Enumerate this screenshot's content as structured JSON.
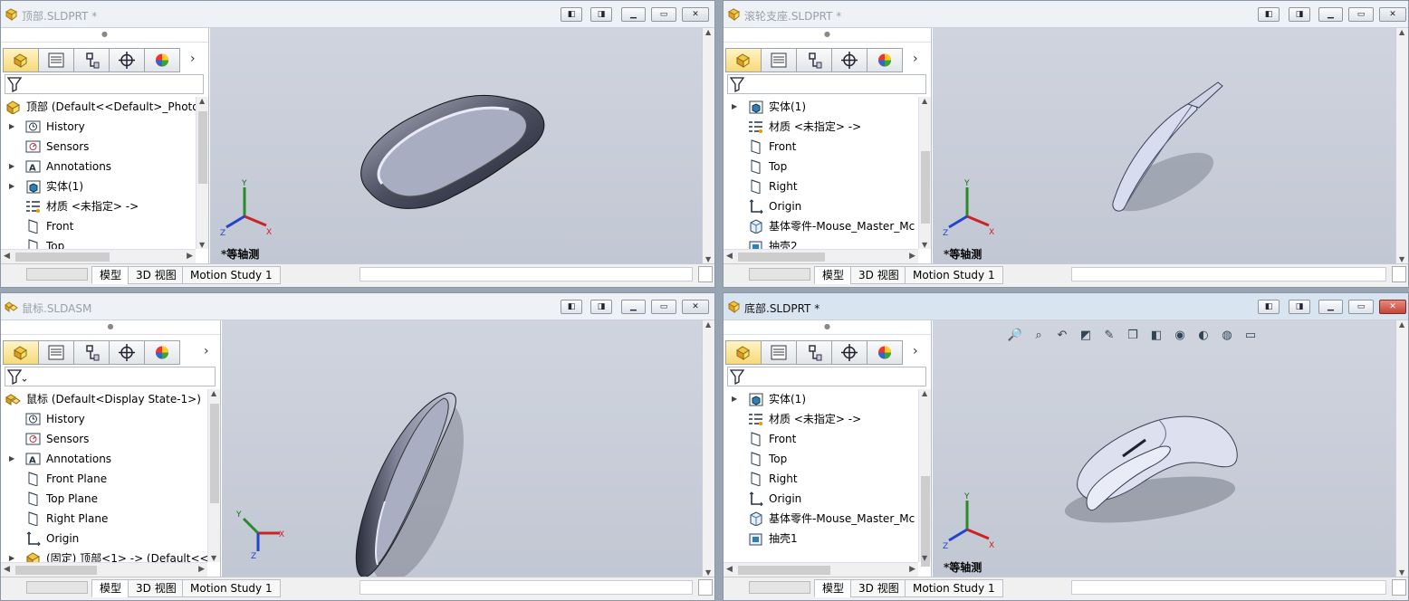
{
  "windows": [
    {
      "id": "w1",
      "title": "顶部.SLDPRT *",
      "active": false,
      "tree": [
        {
          "label": "顶部  (Default<<Default>_Photo",
          "icon": "part-icon",
          "expand": "",
          "root": true
        },
        {
          "label": "History",
          "icon": "history-icon",
          "expand": "▶"
        },
        {
          "label": "Sensors",
          "icon": "sensors-icon",
          "expand": ""
        },
        {
          "label": "Annotations",
          "icon": "annotations-icon",
          "expand": "▶"
        },
        {
          "label": "实体(1)",
          "icon": "solid-body-icon",
          "expand": "▶"
        },
        {
          "label": "材质 <未指定> ->",
          "icon": "material-icon",
          "expand": ""
        },
        {
          "label": "Front",
          "icon": "plane-icon",
          "expand": ""
        },
        {
          "label": "Top",
          "icon": "plane-icon",
          "expand": ""
        }
      ],
      "view_label": "*等轴测",
      "tabs": [
        "模型",
        "3D 视图",
        "Motion Study 1"
      ]
    },
    {
      "id": "w2",
      "title": "滚轮支座.SLDPRT *",
      "active": false,
      "tree": [
        {
          "label": "实体(1)",
          "icon": "solid-body-icon",
          "expand": "▶"
        },
        {
          "label": "材质 <未指定> ->",
          "icon": "material-icon",
          "expand": ""
        },
        {
          "label": "Front",
          "icon": "plane-icon",
          "expand": ""
        },
        {
          "label": "Top",
          "icon": "plane-icon",
          "expand": ""
        },
        {
          "label": "Right",
          "icon": "plane-icon",
          "expand": ""
        },
        {
          "label": "Origin",
          "icon": "origin-icon",
          "expand": ""
        },
        {
          "label": "基体零件-Mouse_Master_Mc",
          "icon": "base-part-icon",
          "expand": ""
        },
        {
          "label": "抽壳2",
          "icon": "shell-icon",
          "expand": ""
        }
      ],
      "view_label": "*等轴测",
      "tabs": [
        "模型",
        "3D 视图",
        "Motion Study 1"
      ]
    },
    {
      "id": "w3",
      "title": "鼠标.SLDASM",
      "active": false,
      "tree": [
        {
          "label": "鼠标  (Default<Display State-1>)",
          "icon": "assembly-icon",
          "expand": "",
          "root": true
        },
        {
          "label": "History",
          "icon": "history-icon",
          "expand": ""
        },
        {
          "label": "Sensors",
          "icon": "sensors-icon",
          "expand": ""
        },
        {
          "label": "Annotations",
          "icon": "annotations-icon",
          "expand": "▶"
        },
        {
          "label": "Front Plane",
          "icon": "plane-icon",
          "expand": ""
        },
        {
          "label": "Top Plane",
          "icon": "plane-icon",
          "expand": ""
        },
        {
          "label": "Right Plane",
          "icon": "plane-icon",
          "expand": ""
        },
        {
          "label": "Origin",
          "icon": "origin-icon",
          "expand": ""
        },
        {
          "label": "(固定) 顶部<1> -> (Default<<[",
          "icon": "part-icon",
          "expand": "▶"
        }
      ],
      "view_label": "",
      "tabs": [
        "模型",
        "3D 视图",
        "Motion Study 1"
      ]
    },
    {
      "id": "w4",
      "title": "底部.SLDPRT *",
      "active": true,
      "tree": [
        {
          "label": "实体(1)",
          "icon": "solid-body-icon",
          "expand": "▶"
        },
        {
          "label": "材质 <未指定> ->",
          "icon": "material-icon",
          "expand": ""
        },
        {
          "label": "Front",
          "icon": "plane-icon",
          "expand": ""
        },
        {
          "label": "Top",
          "icon": "plane-icon",
          "expand": ""
        },
        {
          "label": "Right",
          "icon": "plane-icon",
          "expand": ""
        },
        {
          "label": "Origin",
          "icon": "origin-icon",
          "expand": ""
        },
        {
          "label": "基体零件-Mouse_Master_Mc",
          "icon": "base-part-icon",
          "expand": ""
        },
        {
          "label": "抽壳1",
          "icon": "shell-icon",
          "expand": ""
        }
      ],
      "view_label": "*等轴测",
      "tabs": [
        "模型",
        "3D 视图",
        "Motion Study 1"
      ]
    }
  ],
  "triad_labels": {
    "x": "X",
    "y": "Y",
    "z": "Z"
  },
  "heads_up_toolbar_icons": [
    "zoom-to-fit-icon",
    "zoom-area-icon",
    "previous-view-icon",
    "section-view-icon",
    "dynamic-annotation-icon",
    "view-orientation-icon",
    "display-style-icon",
    "hide-show-icon",
    "edit-appearance-icon",
    "apply-scene-icon",
    "view-settings-icon"
  ],
  "colors": {
    "active_title": "#d9e4f1",
    "close_active": "#c4453a",
    "viewport_bg": "#c9ced9"
  }
}
